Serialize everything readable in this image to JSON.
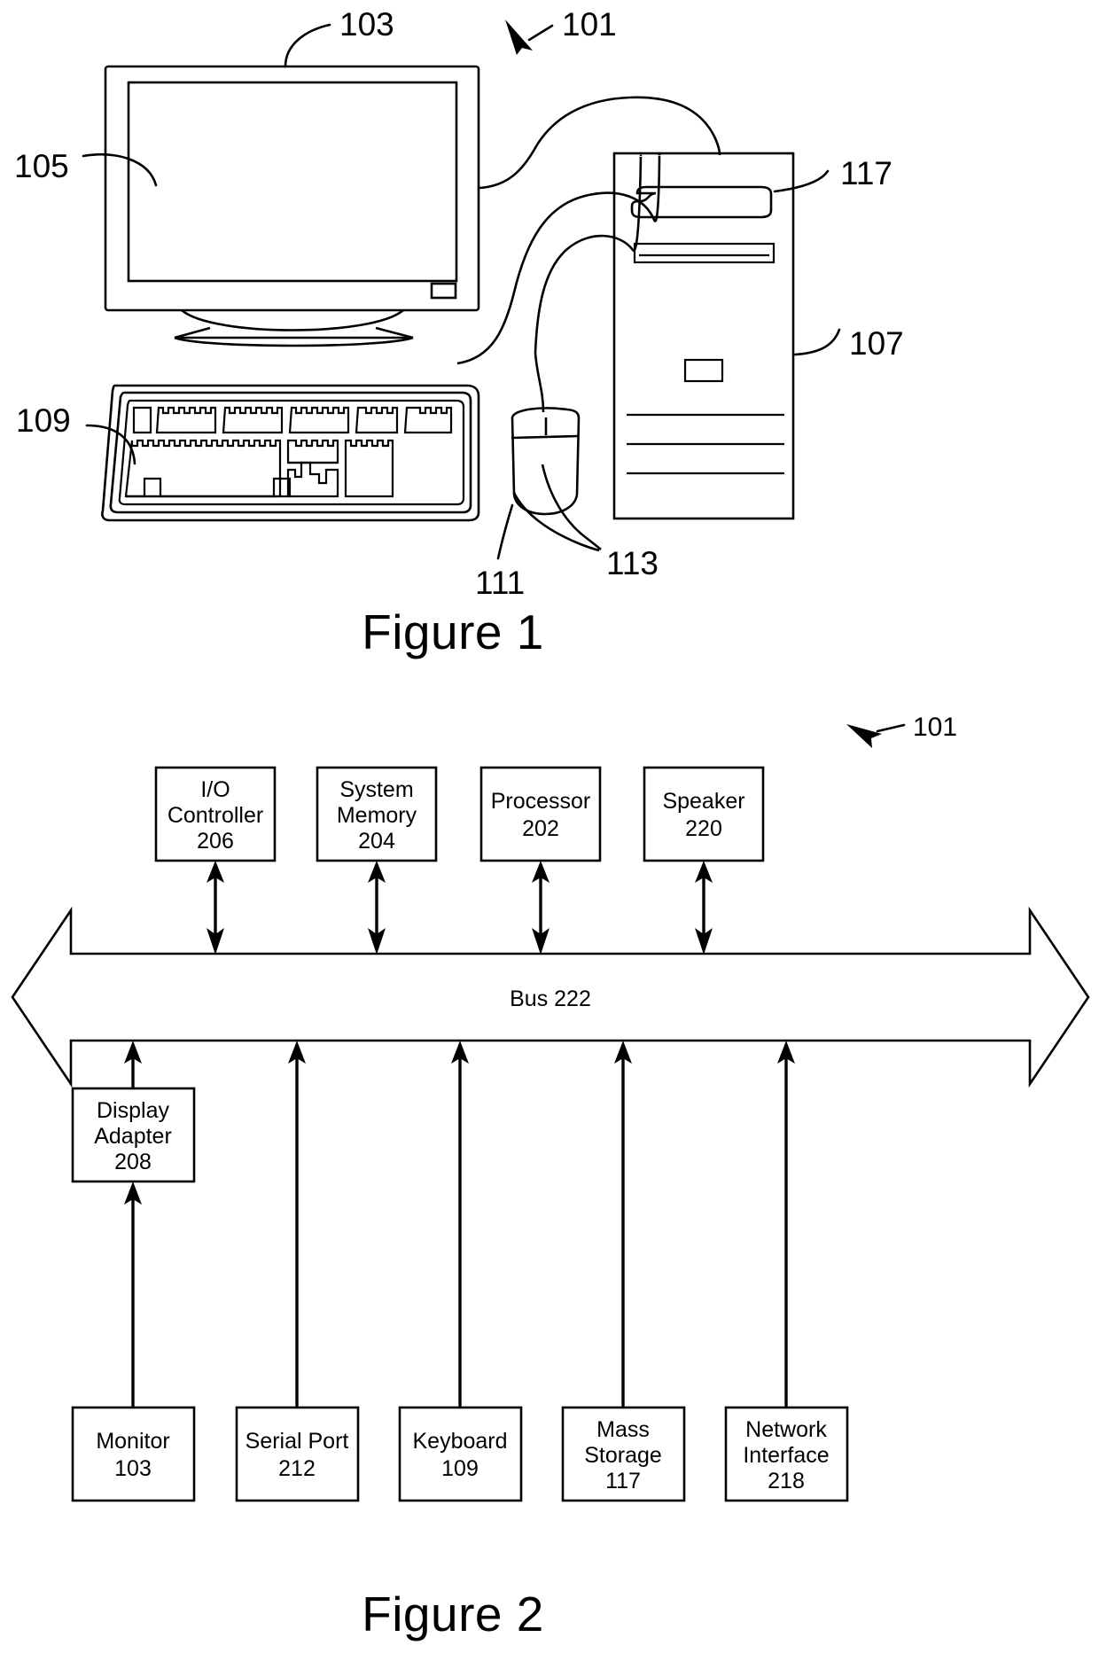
{
  "document": {
    "type": "patent-drawing-sheet",
    "figures": [
      {
        "id": "figure-1",
        "caption": "Figure 1",
        "description": "Computer system hardware illustration",
        "reference_numerals": [
          {
            "label": "101",
            "refers_to": "computer-system"
          },
          {
            "label": "103",
            "refers_to": "monitor"
          },
          {
            "label": "105",
            "refers_to": "display-screen"
          },
          {
            "label": "107",
            "refers_to": "system-tower"
          },
          {
            "label": "109",
            "refers_to": "keyboard"
          },
          {
            "label": "111",
            "refers_to": "mouse"
          },
          {
            "label": "113",
            "refers_to": "mouse-cable"
          },
          {
            "label": "117",
            "refers_to": "mass-storage-drive"
          }
        ]
      },
      {
        "id": "figure-2",
        "caption": "Figure 2",
        "description": "Block diagram of computer system architecture",
        "system_label": "101",
        "bus": {
          "label": "Bus 222",
          "name": "Bus",
          "numeral": "222"
        },
        "top_blocks": [
          {
            "name": "I/O Controller",
            "lines": [
              "I/O",
              "Controller"
            ],
            "numeral": "206"
          },
          {
            "name": "System Memory",
            "lines": [
              "System",
              "Memory"
            ],
            "numeral": "204"
          },
          {
            "name": "Processor",
            "lines": [
              "Processor"
            ],
            "numeral": "202"
          },
          {
            "name": "Speaker",
            "lines": [
              "Speaker"
            ],
            "numeral": "220"
          }
        ],
        "adapter_block": {
          "name": "Display Adapter",
          "lines": [
            "Display",
            "Adapter"
          ],
          "numeral": "208"
        },
        "bottom_blocks": [
          {
            "name": "Monitor",
            "lines": [
              "Monitor"
            ],
            "numeral": "103"
          },
          {
            "name": "Serial Port",
            "lines": [
              "Serial Port"
            ],
            "numeral": "212"
          },
          {
            "name": "Keyboard",
            "lines": [
              "Keyboard"
            ],
            "numeral": "109"
          },
          {
            "name": "Mass Storage",
            "lines": [
              "Mass",
              "Storage"
            ],
            "numeral": "117"
          },
          {
            "name": "Network Interface",
            "lines": [
              "Network",
              "Interface"
            ],
            "numeral": "218"
          }
        ]
      }
    ]
  },
  "colors": {
    "line": "#000000",
    "background": "#ffffff",
    "text": "#000000"
  }
}
